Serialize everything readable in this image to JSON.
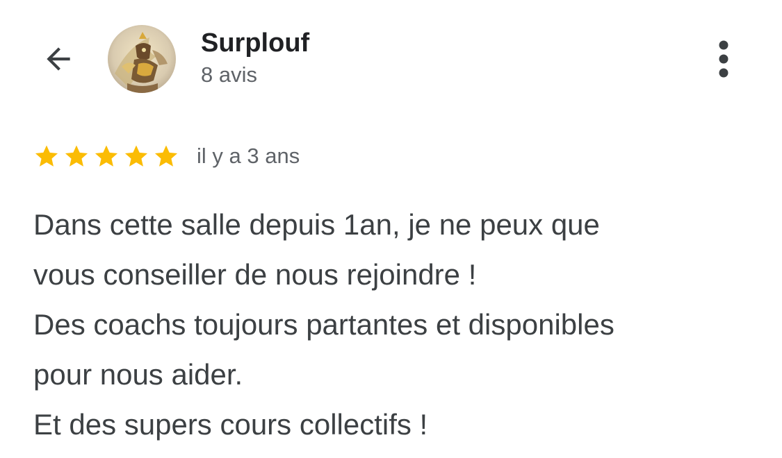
{
  "header": {
    "back_icon": "arrow-left-icon",
    "author_name": "Surplouf",
    "review_count": "8 avis",
    "more_icon": "more-vertical-icon"
  },
  "review": {
    "rating": 5,
    "rating_max": 5,
    "star_color": "#fbbc04",
    "date": "il y a 3 ans",
    "lines": [
      "Dans cette salle depuis 1an, je ne peux que",
      "vous conseiller de nous rejoindre !",
      "Des coachs toujours partantes et disponibles",
      "pour nous aider.",
      "Et des supers cours collectifs !"
    ]
  }
}
